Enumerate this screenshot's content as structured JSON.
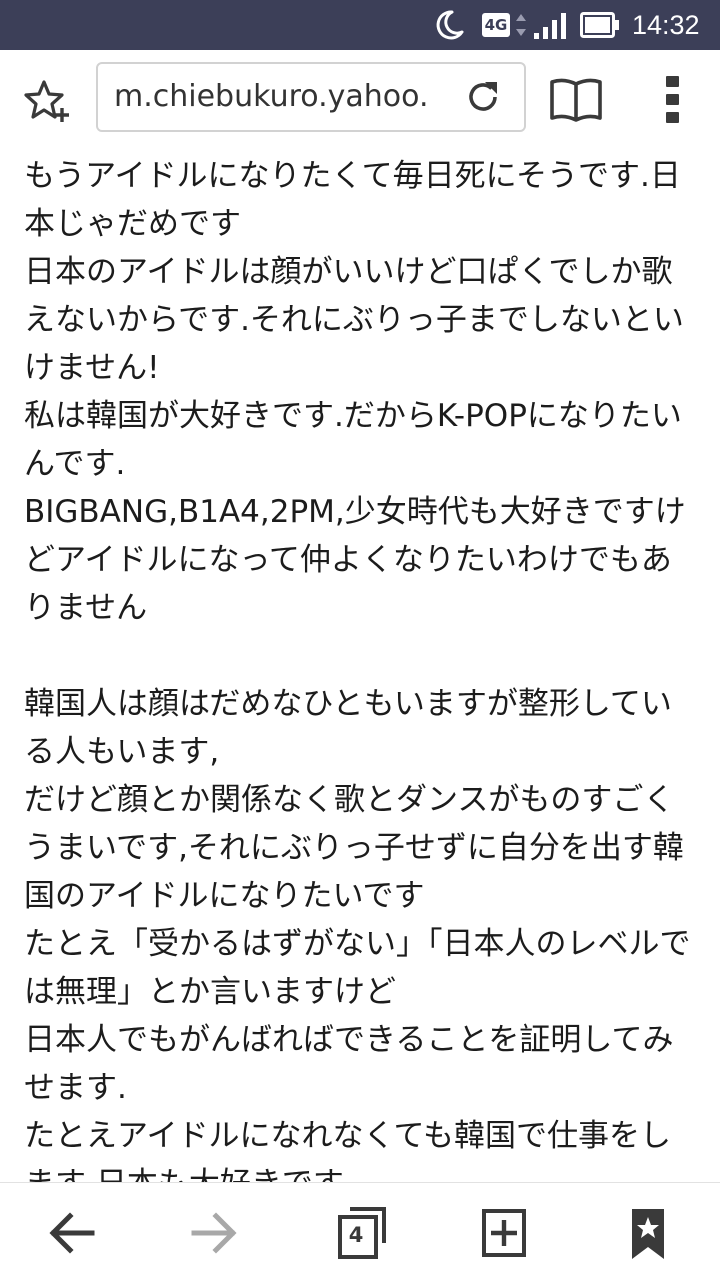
{
  "status_bar": {
    "network": "4G",
    "time": "14:32",
    "icons": [
      "moon-icon",
      "network-4g-icon",
      "data-arrows-icon",
      "signal-icon",
      "battery-icon"
    ]
  },
  "toolbar": {
    "url": "m.chiebukuro.yahoo.",
    "icons": [
      "star-add-icon",
      "reload-icon",
      "reader-icon",
      "overflow-menu-icon"
    ]
  },
  "article": {
    "text": "もうアイドルになりたくて毎日死にそうです.日本じゃだめです\n日本のアイドルは顔がいいけど口ぱくでしか歌えないからです.それにぶりっ子までしないといけません!\n私は韓国が大好きです.だからK-POPになりたいんです.\nBIGBANG,B1A4,2PM,少女時代も大好きですけどアイドルになって仲よくなりたいわけでもありません\n\n韓国人は顔はだめなひともいますが整形している人もいます,\nだけど顔とか関係なく歌とダンスがものすごくうまいです,それにぶりっ子せずに自分を出す韓国のアイドルになりたいです\nたとえ「受かるはずがない」「日本人のレベルでは無理」とか言いますけど\n日本人でもがんばればできることを証明してみせます.\nたとえアイドルになれなくても韓国で仕事をします.日本も大好きです."
  },
  "bottom_bar": {
    "tab_count": "4",
    "icons": [
      "back-arrow-icon",
      "forward-arrow-icon",
      "tabs-icon",
      "new-tab-icon",
      "bookmarks-icon"
    ]
  },
  "colors": {
    "status_bar_bg": "#3c3f58",
    "text": "#1c1c1c",
    "icon": "#3a3a3a",
    "disabled_icon": "#a8a8a8",
    "url_border": "#d2d2d2"
  }
}
